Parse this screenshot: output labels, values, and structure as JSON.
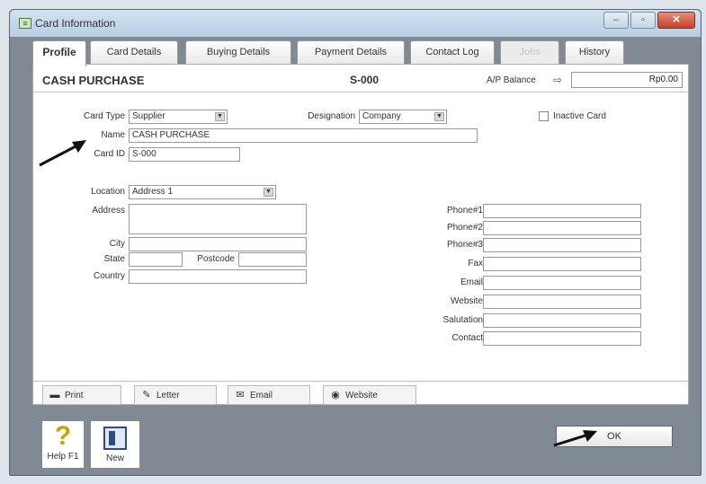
{
  "window": {
    "title": "Card Information",
    "minimize": "–",
    "maximize": "▫",
    "close": "✕"
  },
  "tabs": [
    {
      "label": "Profile"
    },
    {
      "label": "Card Details"
    },
    {
      "label": "Buying Details"
    },
    {
      "label": "Payment Details"
    },
    {
      "label": "Contact Log"
    },
    {
      "label": "Jobs"
    },
    {
      "label": "History"
    }
  ],
  "header": {
    "card_name": "CASH PURCHASE",
    "card_id": "S-000",
    "ap_label": "A/P Balance",
    "ap_value": "Rp0.00"
  },
  "form": {
    "card_type_label": "Card Type",
    "card_type_value": "Supplier",
    "designation_label": "Designation",
    "designation_value": "Company",
    "inactive_label": "Inactive Card",
    "name_label": "Name",
    "name_value": "CASH PURCHASE",
    "card_id_label": "Card ID",
    "card_id_value": "S-000",
    "location_label": "Location",
    "location_value": "Address 1",
    "address_label": "Address",
    "city_label": "City",
    "state_label": "State",
    "postcode_label": "Postcode",
    "country_label": "Country",
    "phone1_label": "Phone#1",
    "phone2_label": "Phone#2",
    "phone3_label": "Phone#3",
    "fax_label": "Fax",
    "email_label": "Email",
    "website_label": "Website",
    "salutation_label": "Salutation",
    "contact_label": "Contact"
  },
  "bottom_buttons": {
    "print": "Print",
    "letter": "Letter",
    "email": "Email",
    "website": "Website"
  },
  "footer": {
    "help_label": "Help F1",
    "new_label": "New",
    "ok_label": "OK"
  }
}
